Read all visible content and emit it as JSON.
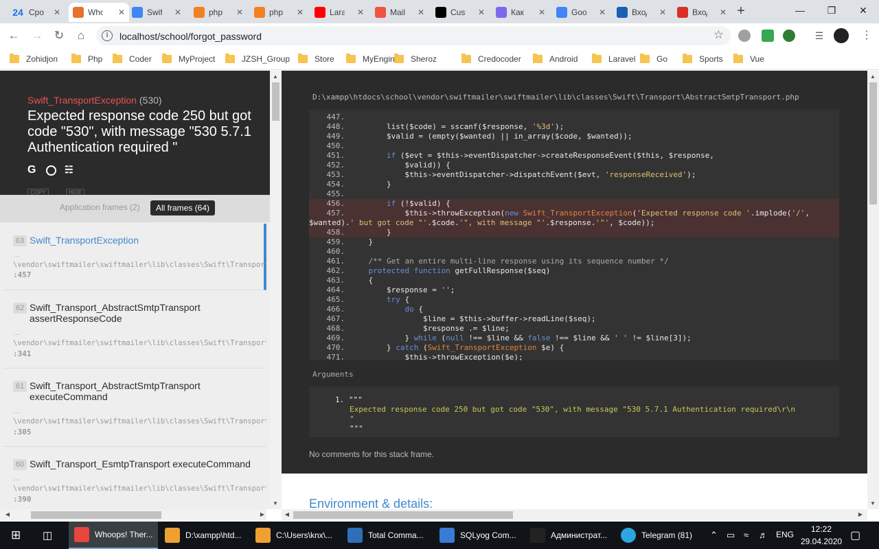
{
  "browser": {
    "tabs": [
      {
        "title": "Cpo",
        "badge": "24",
        "favicon_color": "#1a73e8"
      },
      {
        "title": "Who",
        "favicon_color": "#e8722c",
        "active": true
      },
      {
        "title": "Swift",
        "favicon_color": "#4285f4"
      },
      {
        "title": "php",
        "favicon_color": "#f48024"
      },
      {
        "title": "php",
        "favicon_color": "#f48024"
      },
      {
        "title": "Lara",
        "favicon_color": "#ff0000"
      },
      {
        "title": "Mail",
        "favicon_color": "#f05340"
      },
      {
        "title": "Cust",
        "favicon_color": "#000000"
      },
      {
        "title": "Как",
        "favicon_color": "#7b68ee"
      },
      {
        "title": "Goo",
        "favicon_color": "#4285f4"
      },
      {
        "title": "Вход",
        "favicon_color": "#1b5fb5"
      },
      {
        "title": "Вход",
        "favicon_color": "#d93025"
      }
    ],
    "url": "localhost/school/forgot_password",
    "bookmarks": [
      "Zohidjon",
      "Php",
      "Coder",
      "MyProject",
      "JZSH_Group",
      "Store",
      "MyEngine",
      "Sheroz",
      "Credocoder",
      "Android",
      "Laravel",
      "Go",
      "Sports",
      "Vue"
    ]
  },
  "exception": {
    "class": "Swift_TransportException",
    "code": "(530)",
    "message": "Expected response code 250 but got code \"530\", with message \"530 5.7.1 Authentication required \"",
    "copy_buttons": [
      "COPY",
      "HIDE"
    ]
  },
  "filters": {
    "app_frames": "Application frames (2)",
    "all_frames": "All frames (64)"
  },
  "frames": [
    {
      "num": "63",
      "class": "Swift_TransportException",
      "method": "",
      "dots": "…",
      "path": "\\vendor\\swiftmailer\\swiftmailer\\lib\\classes\\Swift\\TransportException.php",
      "line": ":457"
    },
    {
      "num": "62",
      "class": "Swift_Transport_AbstractSmtpTransport",
      "method": "assertResponseCode",
      "dots": "…",
      "path": "\\vendor\\swiftmailer\\swiftmailer\\lib\\classes\\Swift\\Transport\\AbstractSmtpTransport.php",
      "line": ":341"
    },
    {
      "num": "61",
      "class": "Swift_Transport_AbstractSmtpTransport",
      "method": "executeCommand",
      "dots": "…",
      "path": "\\vendor\\swiftmailer\\swiftmailer\\lib\\classes\\Swift\\Transport\\AbstractSmtpTransport.php",
      "line": ":305"
    },
    {
      "num": "60",
      "class": "Swift_Transport_EsmtpTransport executeCommand",
      "method": "",
      "dots": "…",
      "path": "\\vendor\\swiftmailer\\swiftmailer\\lib\\classes\\Swift\\Transport\\EsmtpTransport.php",
      "line": ":390"
    }
  ],
  "code_view": {
    "file_path": "D:\\xampp\\htdocs\\school\\vendor\\swiftmailer\\swiftmailer\\lib\\classes\\Swift\\Transport\\AbstractSmtpTransport.php",
    "lines": [
      {
        "n": "447.",
        "code": ""
      },
      {
        "n": "448.",
        "code": "        list($code) = sscanf($response, '%3d');"
      },
      {
        "n": "449.",
        "code": "        $valid = (empty($wanted) || in_array($code, $wanted));"
      },
      {
        "n": "450.",
        "code": ""
      },
      {
        "n": "451.",
        "code": "        if ($evt = $this->eventDispatcher->createResponseEvent($this, $response,"
      },
      {
        "n": "452.",
        "code": "            $valid)) {"
      },
      {
        "n": "453.",
        "code": "            $this->eventDispatcher->dispatchEvent($evt, 'responseReceived');"
      },
      {
        "n": "454.",
        "code": "        }"
      },
      {
        "n": "455.",
        "code": ""
      },
      {
        "n": "456.",
        "code": "        if (!$valid) {",
        "hl": true
      },
      {
        "n": "457.",
        "code": "            $this->throwException(new Swift_TransportException('Expected response code '.implode('/',",
        "hl": true
      },
      {
        "n": "",
        "code": "$wanted).' but got code \"'.$code.'\", with message \"'.$response.'\"', $code));",
        "hl": true,
        "wrap": true
      },
      {
        "n": "458.",
        "code": "        }",
        "hl": true
      },
      {
        "n": "459.",
        "code": "    }"
      },
      {
        "n": "460.",
        "code": ""
      },
      {
        "n": "461.",
        "code": "    /** Get an entire multi-line response using its sequence number */"
      },
      {
        "n": "462.",
        "code": "    protected function getFullResponse($seq)"
      },
      {
        "n": "463.",
        "code": "    {"
      },
      {
        "n": "464.",
        "code": "        $response = '';"
      },
      {
        "n": "465.",
        "code": "        try {"
      },
      {
        "n": "466.",
        "code": "            do {"
      },
      {
        "n": "467.",
        "code": "                $line = $this->buffer->readLine($seq);"
      },
      {
        "n": "468.",
        "code": "                $response .= $line;"
      },
      {
        "n": "469.",
        "code": "            } while (null !== $line && false !== $line && ' ' != $line[3]);"
      },
      {
        "n": "470.",
        "code": "        } catch (Swift_TransportException $e) {"
      },
      {
        "n": "471.",
        "code": "            $this->throwException($e);"
      }
    ],
    "arguments_label": "Arguments",
    "arguments": [
      "1. \"\"\"",
      "Expected response code 250 but got code \"530\", with message \"530 5.7.1 Authentication required\\r\\n",
      "\"",
      "\"\"\""
    ],
    "no_comments": "No comments for this stack frame.",
    "env_title": "Environment & details:"
  },
  "taskbar": {
    "items": [
      {
        "label": "Whoops! Ther...",
        "icon_color": "#e8453c",
        "active": true
      },
      {
        "label": "D:\\xampp\\htd...",
        "icon_color": "#f0a030"
      },
      {
        "label": "C:\\Users\\knx\\...",
        "icon_color": "#f0a030"
      },
      {
        "label": "Total Comma...",
        "icon_color": "#2f6fb7"
      },
      {
        "label": "SQLyog Com...",
        "icon_color": "#3a7bd5"
      },
      {
        "label": "Администрат...",
        "icon_color": "#222222"
      },
      {
        "label": "Telegram (81)",
        "icon_color": "#2ca5e0",
        "badge": "81"
      }
    ],
    "lang": "ENG",
    "time": "12:22",
    "date": "29.04.2020"
  }
}
